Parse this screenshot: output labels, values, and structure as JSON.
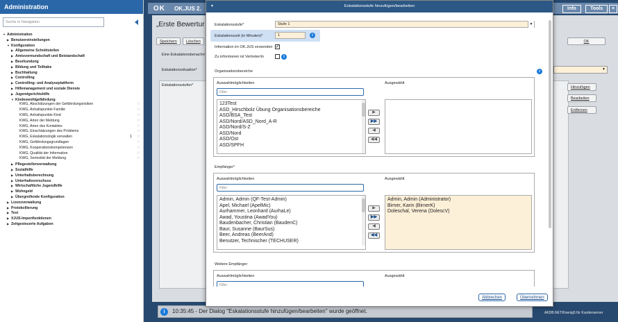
{
  "left": {
    "title": "Administration",
    "search_placeholder": "Suche in Navigation",
    "tree": [
      {
        "label": "Administration",
        "level": 0,
        "bold": true,
        "toggle": "▼"
      },
      {
        "label": "Benutzereinstellungen",
        "level": 1,
        "bold": true,
        "toggle": "▶"
      },
      {
        "label": "Konfiguration",
        "level": 1,
        "bold": true,
        "toggle": "▼"
      },
      {
        "label": "Allgemeine Schnittstellen",
        "level": 2,
        "bold": true,
        "toggle": "▶"
      },
      {
        "label": "Amtsvormundschaft und Beistandschaft",
        "level": 2,
        "bold": true,
        "toggle": "▶"
      },
      {
        "label": "Beurkundung",
        "level": 2,
        "bold": true,
        "toggle": "▶"
      },
      {
        "label": "Bildung und Teilhabe",
        "level": 2,
        "bold": true,
        "toggle": "▶"
      },
      {
        "label": "Buchhaltung",
        "level": 2,
        "bold": true,
        "toggle": "▶"
      },
      {
        "label": "Controlling",
        "level": 2,
        "bold": true,
        "toggle": "▶"
      },
      {
        "label": "Controlling- und Analyseplattform",
        "level": 2,
        "bold": true,
        "toggle": "▶"
      },
      {
        "label": "Hilfemanagement und soziale Dienste",
        "level": 2,
        "bold": true,
        "toggle": "▶"
      },
      {
        "label": "Jugendgerichtshilfe",
        "level": 2,
        "bold": true,
        "toggle": "▶"
      },
      {
        "label": "Kindeswohlgefährdung",
        "level": 2,
        "bold": true,
        "toggle": "▼"
      },
      {
        "label": "KWG, Abschätzungen der Gefährdungsrisiken",
        "level": 3,
        "star": true
      },
      {
        "label": "KWG, Anhaltspunkte Familie",
        "level": 3,
        "star": true
      },
      {
        "label": "KWG, Anhaltspunkte Kind",
        "level": 3,
        "star": true
      },
      {
        "label": "KWG, Arten der Meldung",
        "level": 3,
        "star": true
      },
      {
        "label": "KWG, Arten des Kontaktes",
        "level": 3,
        "star": true
      },
      {
        "label": "KWG, Einschätzungen des Problems",
        "level": 3,
        "star": true
      },
      {
        "label": "KWG, Eskalationslogik verwalten",
        "level": 3,
        "star": true,
        "num": "1"
      },
      {
        "label": "KWG, Gefährdungsgrundlagen",
        "level": 3,
        "star": true
      },
      {
        "label": "KWG, Kooperationskompetenzen",
        "level": 3,
        "star": true
      },
      {
        "label": "KWG, Qualität der Information",
        "level": 3,
        "star": true
      },
      {
        "label": "KWG, Seriosität der Meldung",
        "level": 3,
        "star": true
      },
      {
        "label": "Pflegestellenverwaltung",
        "level": 2,
        "bold": true,
        "toggle": "▶"
      },
      {
        "label": "Sozialhilfe",
        "level": 2,
        "bold": true,
        "toggle": "▶"
      },
      {
        "label": "Unterhaltsberechnung",
        "level": 2,
        "bold": true,
        "toggle": "▶"
      },
      {
        "label": "Unterhaltsvorschuss",
        "level": 2,
        "bold": true,
        "toggle": "▶"
      },
      {
        "label": "Wirtschaftliche Jugendhilfe",
        "level": 2,
        "bold": true,
        "toggle": "▶"
      },
      {
        "label": "Wohngeld",
        "level": 2,
        "bold": true,
        "toggle": "▶"
      },
      {
        "label": "Übergreifende Konfiguration",
        "level": 2,
        "bold": true,
        "toggle": "▶"
      },
      {
        "label": "Lizenzverwaltung",
        "level": 1,
        "bold": true,
        "toggle": "▶"
      },
      {
        "label": "Protokollierung",
        "level": 1,
        "bold": true,
        "toggle": "▶"
      },
      {
        "label": "Test",
        "level": 1,
        "bold": true,
        "toggle": "▶"
      },
      {
        "label": "XJUS-Importfunktionen",
        "level": 1,
        "bold": true,
        "toggle": "▶"
      },
      {
        "label": "Zeitgesteuerte Aufgaben",
        "level": 1,
        "bold": true,
        "toggle": "▶"
      }
    ]
  },
  "app": {
    "logo": "OK",
    "title": "OK.JUS 2.",
    "info_btn": "Info",
    "tools_btn": "Tools",
    "close": "×",
    "heading": "„Erste Bewertur",
    "speichern": "Speichern",
    "loeschen": "Löschen",
    "ok": "OK",
    "eine_esk": "Eine Eskalationsbenachri",
    "esk_situation": "Eskalationssituation*",
    "esk_stufen": "Eskalationsstufen*",
    "hinzufuegen": "Hinzufügen",
    "bearbeiten": "Bearbeiten",
    "entfernen": "Entfernen",
    "status": "10:35:45 - Der Dialog \"Eskalationsstufe hinzufügen/bearbeiten\" wurde geöffnet.",
    "footnote": "AKDB.NET/Koenig5 für Kundenserver"
  },
  "dialog": {
    "title": "Eskalationsstufe hinzufügen/bearbeiten",
    "stufe_label": "Eskalationsstufe*",
    "stufe_value": "Stufe 1",
    "zeit_label": "Eskalationszeit (in Minuten)*",
    "zeit_value": "1",
    "info_label": "Information im OK.JUS versenden",
    "info_checked": true,
    "vertreter_label": "Zu informieren ist Vertreter/in",
    "vertreter_checked": false,
    "org_title": "Organisationsbereiche",
    "ausw": "Auswahlmöglichkeiten",
    "ausg": "Ausgewählt",
    "filter": "Filter",
    "org_options": [
      "123Test",
      "ASD_Hirschbolz Übung Organisationsbereiche",
      "ASD/BSA_Test",
      "ASD/Nord/ASD_Nord_A-R",
      "ASD/Nord/S-Z",
      "ASD/Nord",
      "ASD/Ost",
      "ASD/SPFH"
    ],
    "org_selected": [],
    "empf_title": "Empfänger*",
    "empf_options": [
      "Admin, Admin (QF-Test-Admin)",
      "Apel, Michael (ApelMic)",
      "Aurhammer, Leonhard (AurhaLe)",
      "Awad, Youstina (AwadYou)",
      "Baudenbacher, Christian (BaudenC)",
      "Baur, Susanne (BaurSus)",
      "Beer, Andreas (BeerAnd)",
      "Benutzer, Technischer (TECHUSER)"
    ],
    "empf_selected": [
      "Admin, Admin (Administrator)",
      "Birner, Karin (BirnerK)",
      "Doleschal, Verena (DolescV)"
    ],
    "weitere_title": "Weitere Empfänger",
    "abbrechen": "Abbrechen",
    "uebernehmen": "Übernehmen"
  },
  "colors": {
    "accent": "#2a67a8",
    "dialog_header": "#2c5885",
    "selected_fill": "#fdf0d8"
  }
}
